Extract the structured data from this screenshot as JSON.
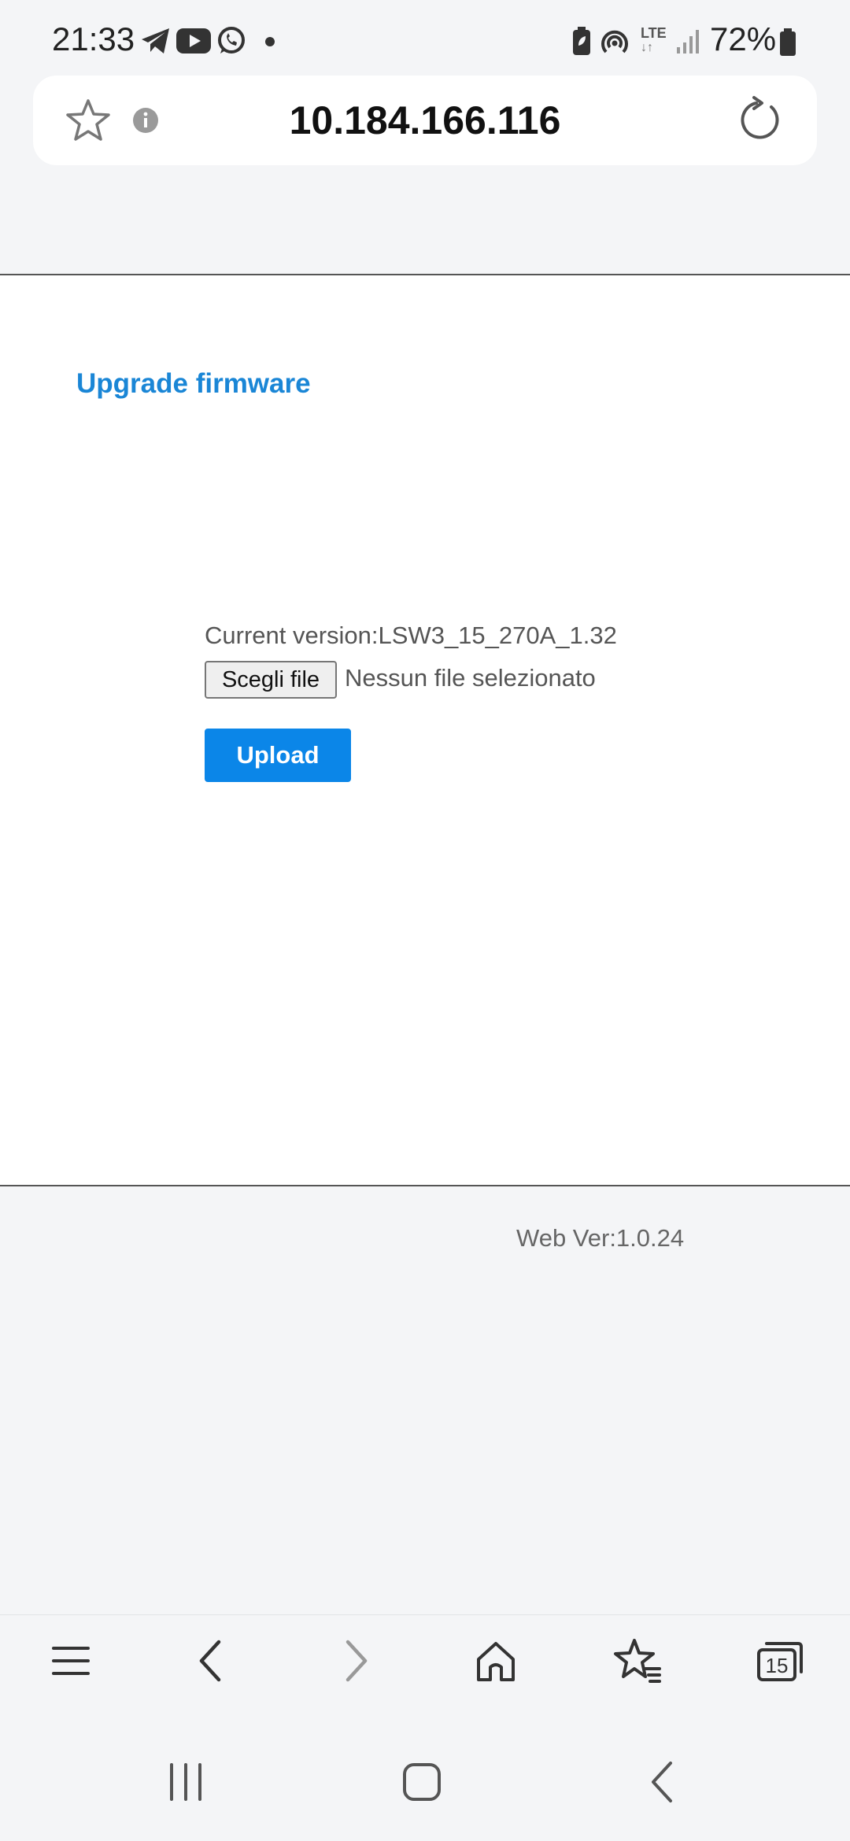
{
  "status_bar": {
    "time": "21:33",
    "battery_percent": "72%",
    "network": "LTE",
    "icons": [
      "telegram-icon",
      "youtube-icon",
      "whatsapp-icon",
      "dot-icon",
      "battery-saver-icon",
      "hotspot-icon",
      "lte-icon",
      "signal-icon",
      "battery-icon"
    ]
  },
  "address_bar": {
    "url": "10.184.166.116"
  },
  "page": {
    "heading": "Upgrade firmware",
    "current_version": "Current version:LSW3_15_270A_1.32",
    "choose_file_label": "Scegli file",
    "file_status": "Nessun file selezionato",
    "upload_label": "Upload",
    "web_version": "Web Ver:1.0.24"
  },
  "toolbar": {
    "tabs_count": "15"
  },
  "colors": {
    "heading": "#1a86d6",
    "upload_button": "#0b86e8",
    "background": "#f4f5f7"
  }
}
